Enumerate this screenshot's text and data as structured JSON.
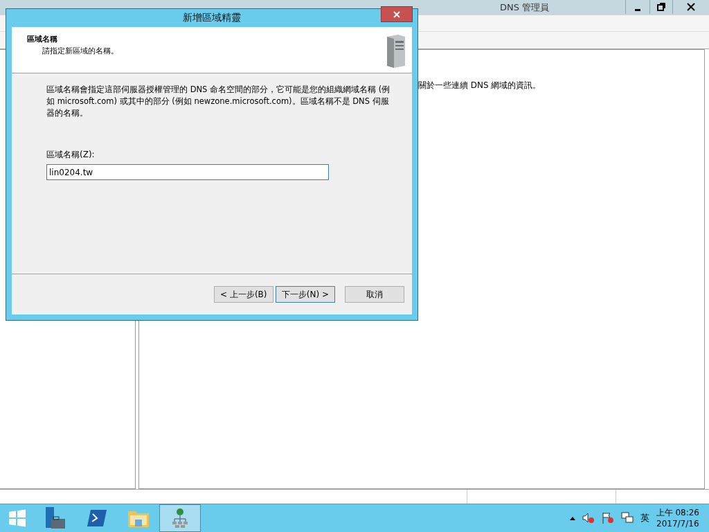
{
  "background_window": {
    "title": "DNS 管理員",
    "right_pane_text": "關於一些連續 DNS 網域的資訊。"
  },
  "dialog": {
    "title": "新增區域精靈",
    "header_title": "區域名稱",
    "header_subtitle": "請指定新區域的名稱。",
    "description": "區域名稱會指定這部伺服器授權管理的 DNS 命名空間的部分，它可能是您的組織網域名稱 (例如 microsoft.com) 或其中的部分 (例如 newzone.microsoft.com)。區域名稱不是 DNS 伺服器的名稱。",
    "field_label": "區域名稱(Z):",
    "field_value": "lin0204.tw",
    "field_focused": true,
    "buttons": [
      {
        "label": "< 上一步(B)",
        "default": false
      },
      {
        "label": "下一步(N) >",
        "default": true
      },
      {
        "label": "取消",
        "default": false
      }
    ]
  },
  "taskbar": {
    "apps": [
      {
        "kind": "server-manager",
        "active": false
      },
      {
        "kind": "powershell",
        "active": false
      },
      {
        "kind": "explorer",
        "active": false
      },
      {
        "kind": "dns",
        "active": true
      }
    ],
    "language": "英",
    "time": "上午 08:26",
    "date": "2017/7/16"
  }
}
